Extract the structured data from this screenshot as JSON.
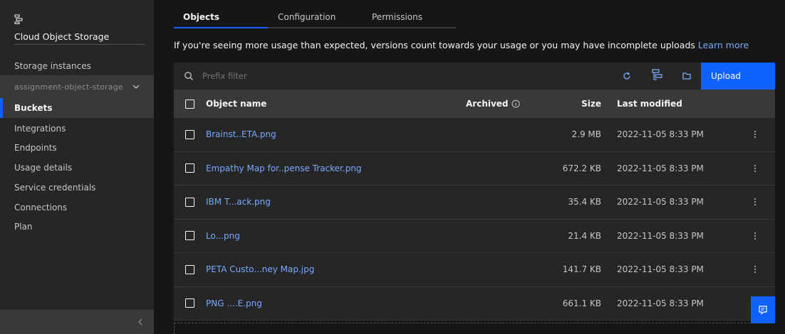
{
  "sidebar": {
    "title": "Cloud Object Storage",
    "storage_instances_label": "Storage instances",
    "instance_selected": "assignment-object-storage",
    "items": [
      {
        "label": "Buckets",
        "active": true
      },
      {
        "label": "Integrations"
      },
      {
        "label": "Endpoints"
      },
      {
        "label": "Usage details"
      },
      {
        "label": "Service credentials"
      },
      {
        "label": "Connections"
      },
      {
        "label": "Plan"
      }
    ]
  },
  "tabs": [
    {
      "label": "Objects",
      "active": true
    },
    {
      "label": "Configuration"
    },
    {
      "label": "Permissions"
    }
  ],
  "notice": {
    "text": "If you're seeing more usage than expected, versions count towards your usage or you may have incomplete uploads",
    "link": "Learn more"
  },
  "toolbar": {
    "search_placeholder": "Prefix filter",
    "upload_label": "Upload",
    "icons": [
      "refresh-icon",
      "hierarchy-icon",
      "folder-icon"
    ]
  },
  "table": {
    "headers": {
      "name": "Object name",
      "archived": "Archived",
      "size": "Size",
      "modified": "Last modified"
    },
    "rows": [
      {
        "name": "Brainst..ETA.png",
        "size": "2.9 MB",
        "modified": "2022-11-05 8:33 PM"
      },
      {
        "name": "Empathy Map for..pense Tracker.png",
        "size": "672.2 KB",
        "modified": "2022-11-05 8:33 PM"
      },
      {
        "name": "IBM T...ack.png",
        "size": "35.4 KB",
        "modified": "2022-11-05 8:33 PM"
      },
      {
        "name": "Lo...png",
        "size": "21.4 KB",
        "modified": "2022-11-05 8:33 PM"
      },
      {
        "name": "PETA Custo...ney Map.jpg",
        "size": "141.7 KB",
        "modified": "2022-11-05 8:33 PM"
      },
      {
        "name": "PNG ....E.png",
        "size": "661.1 KB",
        "modified": "2022-11-05 8:33 PM"
      }
    ]
  },
  "colors": {
    "accent": "#0f62fe",
    "link": "#78a9ff",
    "background": "#161616",
    "surface": "#262626"
  }
}
